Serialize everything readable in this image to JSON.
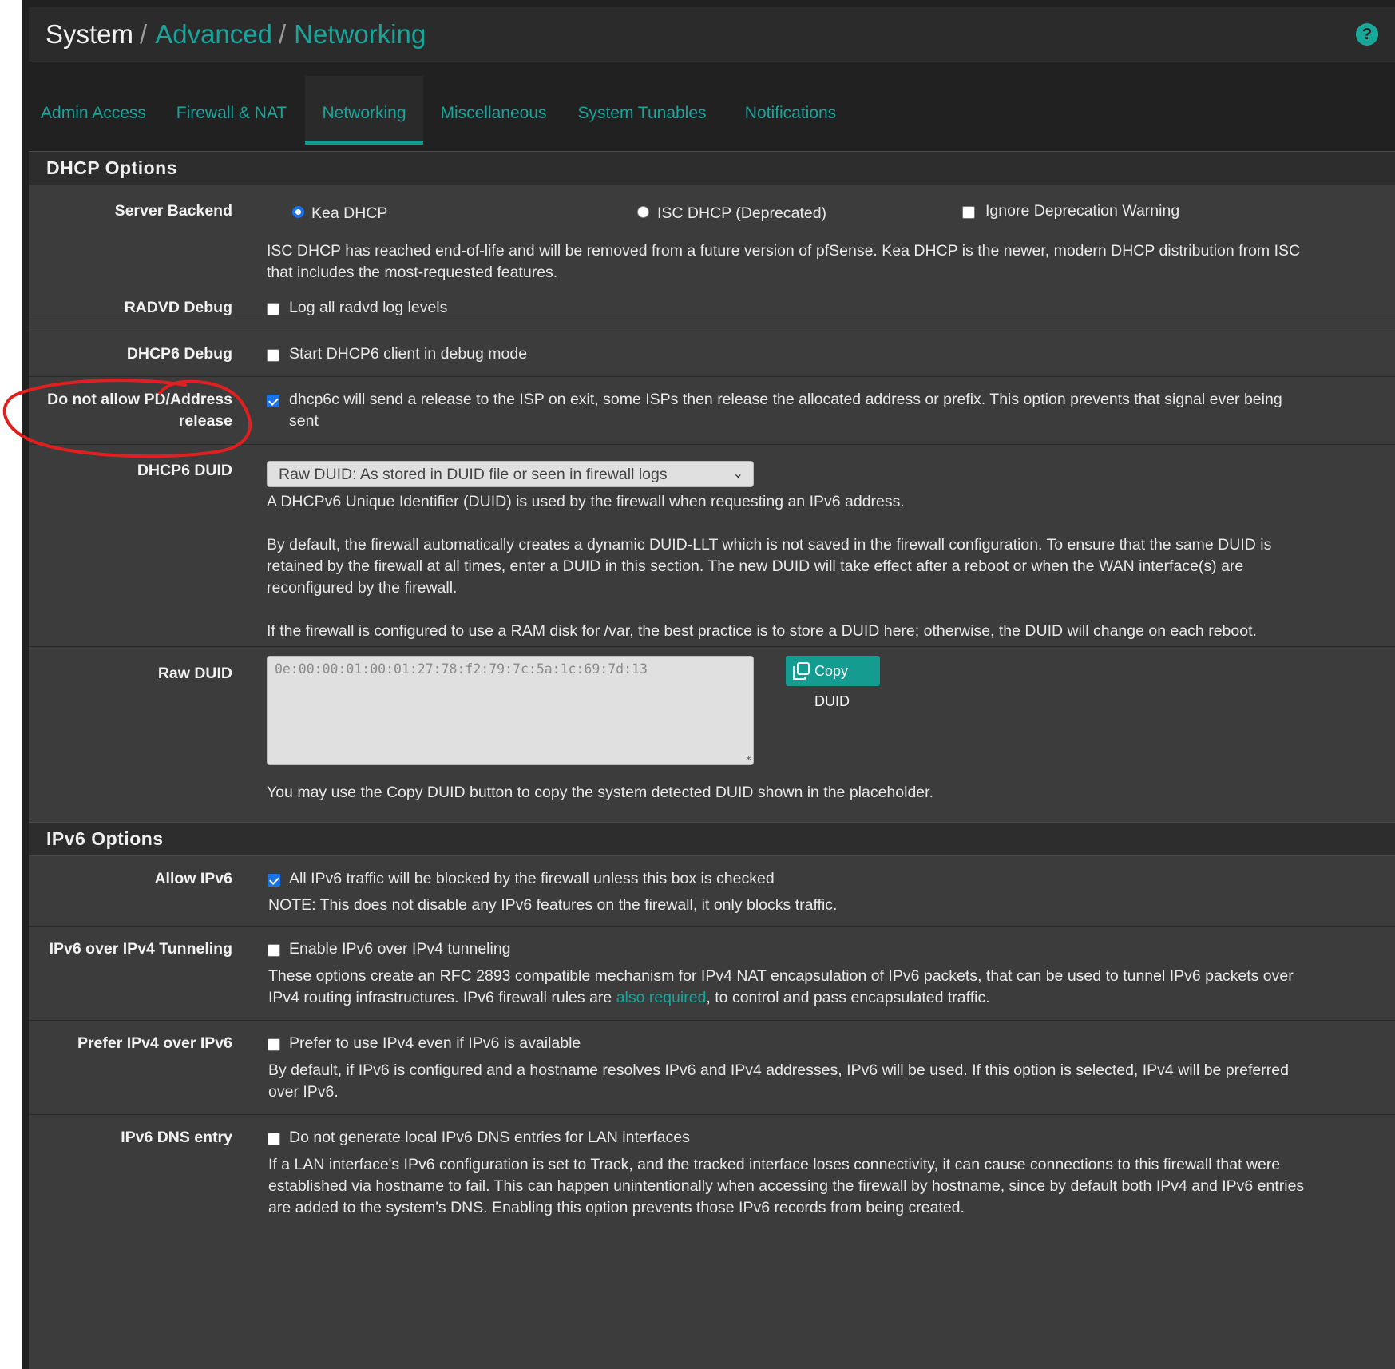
{
  "breadcrumb": {
    "root": "System",
    "level2": "Advanced",
    "level3": "Networking"
  },
  "help_icon": "?",
  "tabs": [
    {
      "label": "Admin Access"
    },
    {
      "label": "Firewall & NAT"
    },
    {
      "label": "Networking",
      "active": true
    },
    {
      "label": "Miscellaneous"
    },
    {
      "label": "System Tunables"
    },
    {
      "label": "Notifications"
    }
  ],
  "dhcp": {
    "title": "DHCP Options",
    "server_backend": {
      "label": "Server Backend",
      "kea": "Kea DHCP",
      "isc": "ISC DHCP (Deprecated)",
      "ignore": "Ignore Deprecation Warning",
      "help1": "ISC DHCP has reached end-of-life and will be removed from a future version of pfSense. Kea DHCP is the newer, modern DHCP distribution from ISC",
      "help2": "that includes the most-requested features."
    },
    "radvd": {
      "label": "RADVD Debug",
      "text": "Log all radvd log levels"
    },
    "dhcp6debug": {
      "label": "DHCP6 Debug",
      "text": "Start DHCP6 client in debug mode"
    },
    "pd_release": {
      "label1": "Do not allow PD/Address",
      "label2": "release",
      "text1": "dhcp6c will send a release to the ISP on exit, some ISPs then release the allocated address or prefix. This option prevents that signal ever being",
      "text2": "sent"
    },
    "duid": {
      "label": "DHCP6 DUID",
      "select_value": "Raw DUID: As stored in DUID file or seen in firewall logs",
      "help1": "A DHCPv6 Unique Identifier (DUID) is used by the firewall when requesting an IPv6 address.",
      "help2a": "By default, the firewall automatically creates a dynamic DUID-LLT which is not saved in the firewall configuration. To ensure that the same DUID is",
      "help2b": "retained by the firewall at all times, enter a DUID in this section. The new DUID will take effect after a reboot or when the WAN interface(s) are",
      "help2c": "reconfigured by the firewall.",
      "help3": "If the firewall is configured to use a RAM disk for /var, the best practice is to store a DUID here; otherwise, the DUID will change on each reboot."
    },
    "raw_duid": {
      "label": "Raw DUID",
      "placeholder": "0e:00:00:01:00:01:27:78:f2:79:7c:5a:1c:69:7d:13",
      "button": "Copy DUID",
      "help": "You may use the Copy DUID button to copy the system detected DUID shown in the placeholder."
    }
  },
  "ipv6": {
    "title": "IPv6 Options",
    "allow": {
      "label": "Allow IPv6",
      "text": "All IPv6 traffic will be blocked by the firewall unless this box is checked",
      "note": "NOTE: This does not disable any IPv6 features on the firewall, it only blocks traffic."
    },
    "tunnel": {
      "label": "IPv6 over IPv4 Tunneling",
      "text": "Enable IPv6 over IPv4 tunneling",
      "help1": "These options create an RFC 2893 compatible mechanism for IPv4 NAT encapsulation of IPv6 packets, that can be used to tunnel IPv6 packets over",
      "help2a": "IPv4 routing infrastructures. IPv6 firewall rules are ",
      "help2link": "also required",
      "help2b": ", to control and pass encapsulated traffic."
    },
    "prefer": {
      "label": "Prefer IPv4 over IPv6",
      "text": "Prefer to use IPv4 even if IPv6 is available",
      "help1": "By default, if IPv6 is configured and a hostname resolves IPv6 and IPv4 addresses, IPv6 will be used. If this option is selected, IPv4 will be preferred",
      "help2": "over IPv6."
    },
    "dns": {
      "label": "IPv6 DNS entry",
      "text": "Do not generate local IPv6 DNS entries for LAN interfaces",
      "help1": "If a LAN interface's IPv6 configuration is set to Track, and the tracked interface loses connectivity, it can cause connections to this firewall that were",
      "help2": "established via hostname to fail. This can happen unintentionally when accessing the firewall by hostname, since by default both IPv4 and IPv6 entries",
      "help3": "are added to the system's DNS. Enabling this option prevents those IPv6 records from being created."
    }
  },
  "colors": {
    "accent": "#1aa59b",
    "annotation": "#e02020",
    "checkbox": "#1a73e8"
  }
}
